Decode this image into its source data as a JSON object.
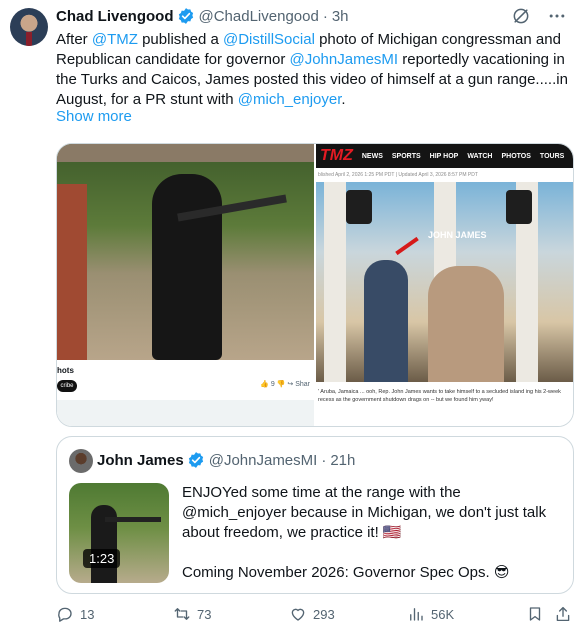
{
  "tweet": {
    "author": {
      "display_name": "Chad Livengood",
      "handle": "@ChadLivengood",
      "time": "3h"
    },
    "body": {
      "p1": "After ",
      "m1": "@TMZ",
      "p2": " published a ",
      "m2": "@DistillSocial",
      "p3": " photo of Michigan congressman and Republican candidate for governor ",
      "m3": "@JohnJamesMI",
      "p4": " reportedly vacationing in the Turks and Caicos, James posted this video of himself at a gun range.....in August, for a PR stunt with ",
      "m4": "@mich_enjoyer",
      "p5": "."
    },
    "show_more": "Show more"
  },
  "media": {
    "left": {
      "caption": "hots",
      "pill": "cribe",
      "stats": "👍 9   👎   ↪ Shar"
    },
    "right": {
      "logo": "TMZ",
      "nav": [
        "NEWS",
        "SPORTS",
        "HIP HOP",
        "WATCH",
        "PHOTOS",
        "TOURS"
      ],
      "meta": "blished April 2, 2026 1:25 PM PDT  |  Updated April 3, 2026 8:57 PM PDT",
      "photo_label": "JOHN JAMES",
      "caption": "' Aruba, Jamaica ... ooh, Rep. John James wants to take himself to a secluded island ing his 2-week recess as the government shutdown drags on -- but we found him yway!"
    }
  },
  "quote": {
    "display_name": "John James",
    "handle": "@JohnJamesMI",
    "time": "21h",
    "duration": "1:23",
    "line1": "ENJOYed some time at the range with the @mich_enjoyer because in Michigan, we don't just talk about freedom, we practice it! 🇺🇸",
    "line2": "Coming November 2026: Governor Spec Ops. 😎"
  },
  "actions": {
    "replies": "13",
    "reposts": "73",
    "likes": "293",
    "views": "56K"
  },
  "icons": {
    "verified": "verified-badge-icon",
    "grok": "grok-icon",
    "more": "more-icon",
    "reply": "reply-icon",
    "repost": "repost-icon",
    "like": "like-icon",
    "views": "views-icon",
    "bookmark": "bookmark-icon",
    "share": "share-icon"
  },
  "colors": {
    "link": "#1d9bf0",
    "muted": "#536471",
    "verified": "#1d9bf0",
    "tmz_red": "#e41b23"
  }
}
